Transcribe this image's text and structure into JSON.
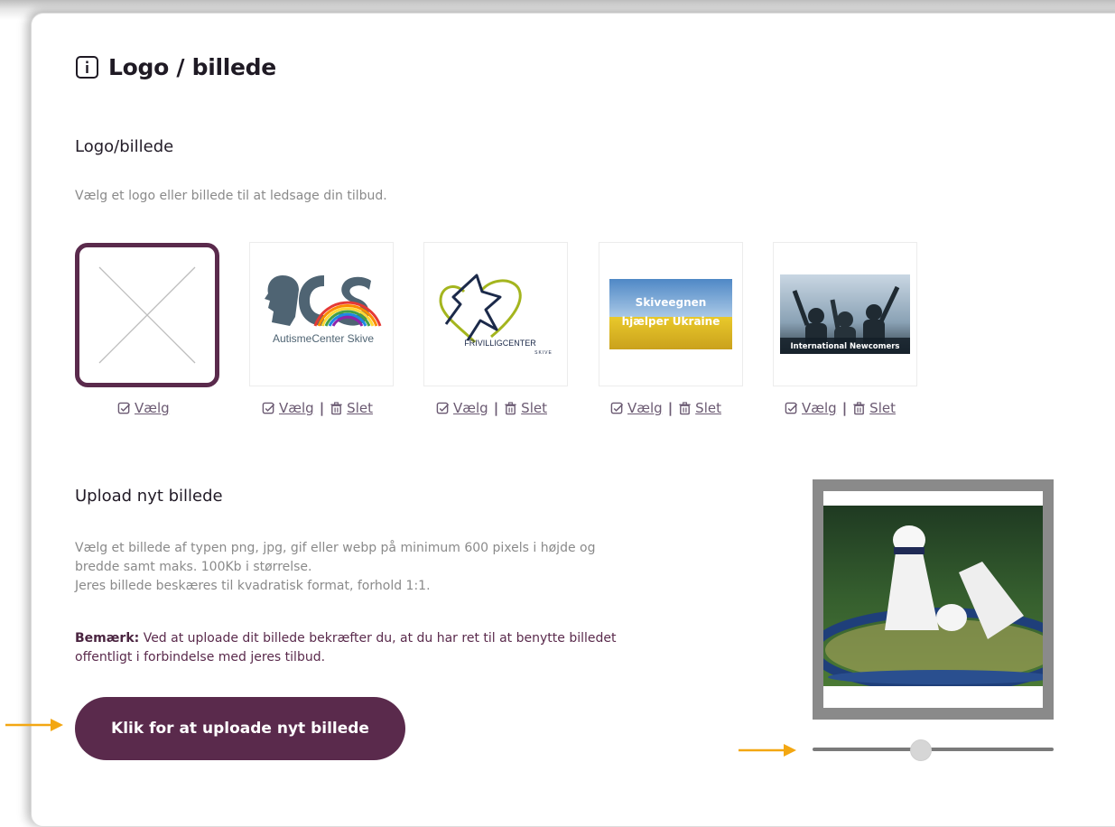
{
  "section": {
    "title": "Logo / billede"
  },
  "logo": {
    "heading": "Logo/billede",
    "description": "Vælg et logo eller billede til at ledsage din tilbud.",
    "tiles": [
      {
        "id": "none",
        "select_label": "Vælg"
      },
      {
        "id": "acs",
        "image_text": "AutismeCenter Skive",
        "select_label": "Vælg",
        "delete_label": "Slet"
      },
      {
        "id": "frivilligcenter",
        "image_text": "FRIVILLIGCENTER",
        "image_subtext": "SKIVE",
        "select_label": "Vælg",
        "delete_label": "Slet"
      },
      {
        "id": "ukraine",
        "image_text_line1": "Skiveegnen",
        "image_text_line2": "hjælper Ukraine",
        "select_label": "Vælg",
        "delete_label": "Slet"
      },
      {
        "id": "newcomers",
        "image_text": "International Newcomers",
        "select_label": "Vælg",
        "delete_label": "Slet"
      }
    ]
  },
  "upload": {
    "heading": "Upload nyt billede",
    "description_line1": "Vælg et billede af typen png, jpg, gif eller webp på minimum 600 pixels i højde og",
    "description_line2": "bredde samt maks. 100Kb i størrelse.",
    "description_line3": "Jeres billede beskæres til kvadratisk format, forhold 1:1.",
    "note_label": "Bemærk:",
    "note_text": " Ved at uploade dit billede bekræfter du, at du har ret til at benytte billedet",
    "note_text_line2": "offentligt i forbindelse med jeres tilbud.",
    "button_label": "Klik for at uploade nyt billede"
  },
  "preview": {
    "zoom_fraction": 0.44
  },
  "colors": {
    "brand": "#5a2a4c",
    "arrow": "#f3a712"
  }
}
